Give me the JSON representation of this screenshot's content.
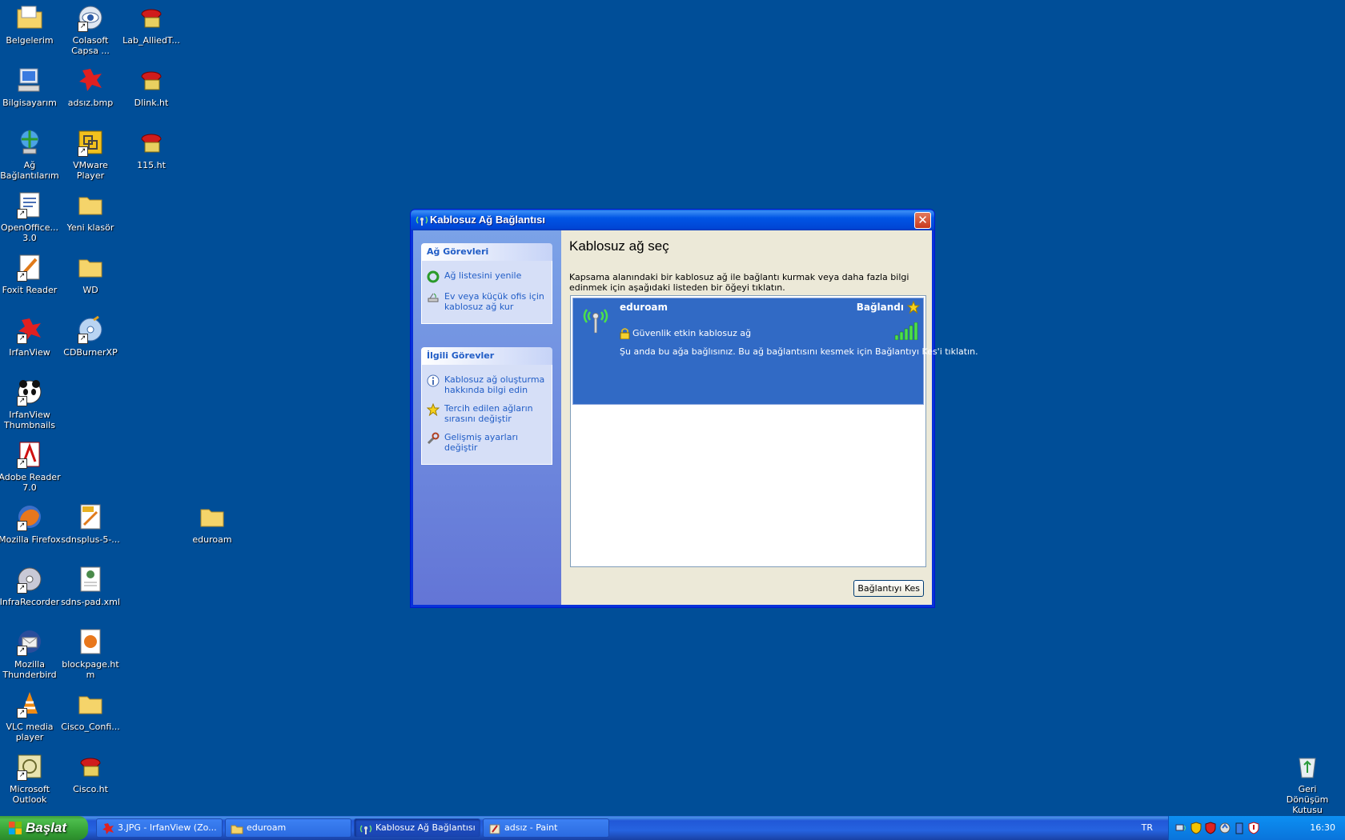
{
  "desktop": {
    "icons": [
      {
        "label": "Belgelerim"
      },
      {
        "label": "Colasoft Capsa ..."
      },
      {
        "label": "Lab_AlliedT..."
      },
      {
        "label": "Bilgisayarım"
      },
      {
        "label": "adsız.bmp"
      },
      {
        "label": "Dlink.ht"
      },
      {
        "label": "Ağ Bağlantılarım"
      },
      {
        "label": "VMware Player"
      },
      {
        "label": "115.ht"
      },
      {
        "label": "OpenOffice... 3.0"
      },
      {
        "label": "Yeni klasör"
      },
      {
        "label": "Foxit Reader"
      },
      {
        "label": "WD"
      },
      {
        "label": "IrfanView"
      },
      {
        "label": "CDBurnerXP"
      },
      {
        "label": "IrfanView Thumbnails"
      },
      {
        "label": "Adobe Reader 7.0"
      },
      {
        "label": "Mozilla Firefox"
      },
      {
        "label": "sdnsplus-5-..."
      },
      {
        "label": "eduroam"
      },
      {
        "label": "InfraRecorder"
      },
      {
        "label": "sdns-pad.xml"
      },
      {
        "label": "Mozilla Thunderbird"
      },
      {
        "label": "blockpage.htm"
      },
      {
        "label": "VLC media player"
      },
      {
        "label": "Cisco_Confi..."
      },
      {
        "label": "Microsoft Outlook"
      },
      {
        "label": "Cisco.ht"
      },
      {
        "label": "Geri Dönüşüm Kutusu"
      }
    ]
  },
  "window": {
    "title": "Kablosuz Ağ Bağlantısı",
    "close_label": "✕",
    "tasks": {
      "network_tasks_title": "Ağ Görevleri",
      "network_tasks": [
        {
          "label": "Ağ listesini yenile"
        },
        {
          "label": "Ev veya küçük ofis için kablosuz ağ kur"
        }
      ],
      "related_tasks_title": "İlgili Görevler",
      "related_tasks": [
        {
          "label": "Kablosuz ağ oluşturma hakkında bilgi edin"
        },
        {
          "label": "Tercih edilen ağların sırasını değiştir"
        },
        {
          "label": "Gelişmiş ayarları değiştir"
        }
      ]
    },
    "heading": "Kablosuz ağ seç",
    "description": "Kapsama alanındaki bir kablosuz ağ ile bağlantı kurmak veya daha fazla bilgi edinmek için aşağıdaki listeden bir öğeyi tıklatın.",
    "network": {
      "name": "eduroam",
      "status": "Bağlandı",
      "security": "Güvenlik etkin kablosuz ağ",
      "info": "Şu anda bu ağa bağlısınız. Bu ağ bağlantısını kesmek için Bağlantıyı Kes'i tıklatın.",
      "signal_bars": 5
    },
    "disconnect_button": "Bağlantıyı Kes"
  },
  "taskbar": {
    "start_label": "Başlat",
    "buttons": [
      {
        "label": "3.JPG - IrfanView (Zo..."
      },
      {
        "label": "eduroam"
      },
      {
        "label": "Kablosuz Ağ Bağlantısı"
      },
      {
        "label": "adsız - Paint"
      }
    ],
    "language": "TR",
    "clock": "16:30"
  },
  "colors": {
    "desktop": "#004e98",
    "selection": "#316ac5",
    "task_link": "#215dc6"
  }
}
